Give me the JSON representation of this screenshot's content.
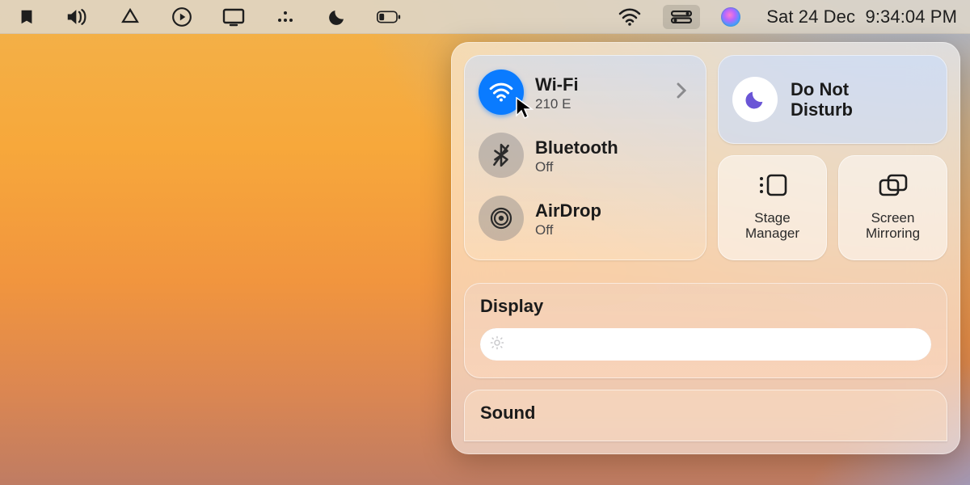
{
  "menubar": {
    "icons": [
      "bookmark",
      "volume",
      "drive",
      "play",
      "display",
      "dots",
      "moon",
      "battery",
      "wifi",
      "control-center",
      "siri"
    ],
    "datetime": "Sat 24 Dec  9:34:04 PM"
  },
  "control_center": {
    "connectivity": {
      "wifi": {
        "title": "Wi-Fi",
        "subtitle": "210 E",
        "on": true
      },
      "bluetooth": {
        "title": "Bluetooth",
        "subtitle": "Off",
        "on": false
      },
      "airdrop": {
        "title": "AirDrop",
        "subtitle": "Off",
        "on": false
      }
    },
    "dnd": {
      "label": "Do Not\nDisturb"
    },
    "stage": {
      "label": "Stage\nManager"
    },
    "mirror": {
      "label": "Screen\nMirroring"
    },
    "display": {
      "title": "Display",
      "brightness_percent": 100
    },
    "sound": {
      "title": "Sound"
    }
  }
}
